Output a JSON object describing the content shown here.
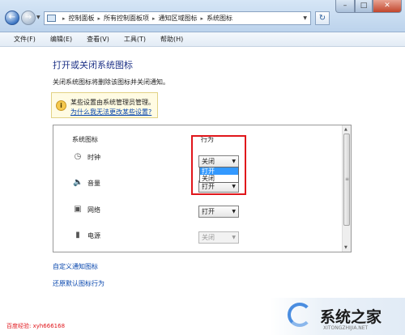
{
  "address_bar": {
    "breadcrumbs": [
      "控制面板",
      "所有控制面板项",
      "通知区域图标",
      "系统图标"
    ]
  },
  "menu": [
    "文件(F)",
    "编辑(E)",
    "查看(V)",
    "工具(T)",
    "帮助(H)"
  ],
  "content": {
    "title": "打开或关闭系统图标",
    "description": "关闭系统图标将删除该图标并关闭通知。",
    "info_text": "某些设置由系统管理员管理。",
    "info_link": "为什么我无法更改某些设置?",
    "header_icons": "系统图标",
    "header_behavior": "行为",
    "rows": [
      {
        "name": "时钟",
        "value": "关闭",
        "enabled": true
      },
      {
        "name": "音量",
        "value": "打开",
        "enabled": true
      },
      {
        "name": "网络",
        "value": "打开",
        "enabled": true
      },
      {
        "name": "电源",
        "value": "关闭",
        "enabled": false
      }
    ],
    "dropdown_options": [
      "打开",
      "关闭"
    ],
    "link_customize": "自定义通知图标",
    "link_restore": "还原默认图标行为"
  },
  "watermarks": {
    "baidu": "百度经验: xyh666168",
    "brand": "系统之家",
    "url": "XITONGZHIJIA.NET"
  },
  "colors": {
    "highlight_box": "#e0161b",
    "dropdown_selected": "#3399ff",
    "link": "#0645ad",
    "title": "#1e3287"
  }
}
